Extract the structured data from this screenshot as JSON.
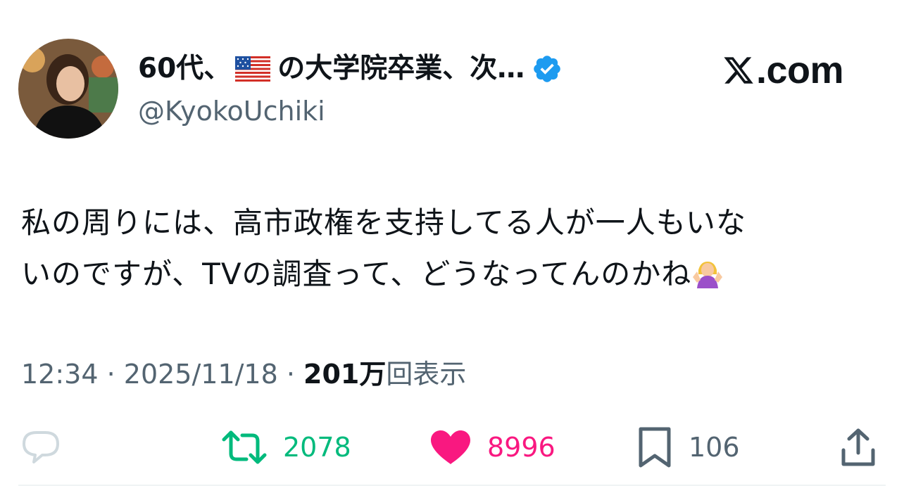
{
  "header": {
    "display_name": "60代、",
    "display_name_rest": "の大学院卒業、次…",
    "flag": "us-flag",
    "verified": true,
    "handle": "@KyokoUchiki",
    "site_brand": ".com"
  },
  "tweet": {
    "line1": "私の周りには、高市政権を支持してる人が一人もいな",
    "line2": "いのですが、TVの調査って、どうなってんのかね",
    "emoji": "person-shrugging"
  },
  "meta": {
    "time": "12:34",
    "separator1": " · ",
    "date": "2025/11/18",
    "separator2": " · ",
    "views_count": "201万",
    "views_label": "回表示"
  },
  "actions": {
    "replies": "",
    "retweets": "2078",
    "likes": "8996",
    "bookmarks": "106"
  },
  "colors": {
    "text": "#0f1419",
    "secondary": "#536471",
    "retweet": "#00ba7c",
    "like": "#f91880",
    "verified": "#1d9bf0"
  }
}
